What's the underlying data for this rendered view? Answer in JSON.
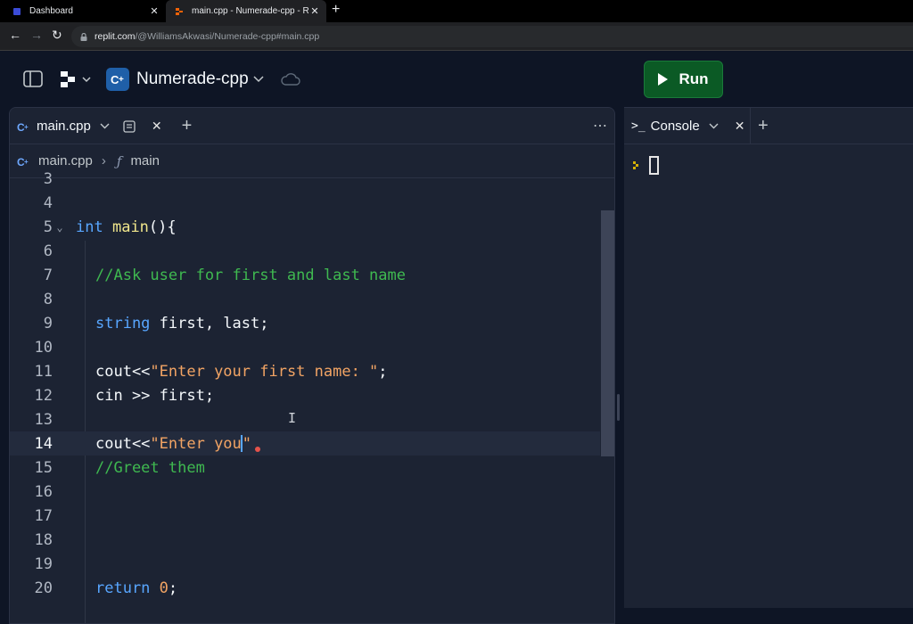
{
  "browser": {
    "tabs": [
      {
        "title": "Dashboard",
        "active": false
      },
      {
        "title": "main.cpp - Numerade-cpp - Replit",
        "active": true
      }
    ],
    "url_host": "replit.com",
    "url_path": "/@WilliamsAkwasi/Numerade-cpp#main.cpp"
  },
  "header": {
    "repl_name": "Numerade-cpp",
    "run_label": "Run"
  },
  "editor": {
    "tab_label": "main.cpp",
    "breadcrumb": {
      "file": "main.cpp",
      "symbol": "main"
    },
    "lines": [
      {
        "n": "3"
      },
      {
        "n": "4"
      },
      {
        "n": "5"
      },
      {
        "n": "6"
      },
      {
        "n": "7"
      },
      {
        "n": "8"
      },
      {
        "n": "9"
      },
      {
        "n": "10"
      },
      {
        "n": "11"
      },
      {
        "n": "12"
      },
      {
        "n": "13"
      },
      {
        "n": "14"
      },
      {
        "n": "15"
      },
      {
        "n": "16"
      },
      {
        "n": "17"
      },
      {
        "n": "18"
      },
      {
        "n": "19"
      },
      {
        "n": "20"
      }
    ],
    "code": {
      "l5_kw": "int",
      "l5_fn": "main",
      "l5_rest": "(){",
      "l7": "//Ask user for first and last name",
      "l9_kw": "string",
      "l9_rest": " first, last;",
      "l11_a": "cout<<",
      "l11_str": "\"Enter your first name: \"",
      "l11_b": ";",
      "l12": "cin >> first;",
      "l14_a": "cout<<",
      "l14_str": "\"Enter you",
      "l14_str2": "\"",
      "l15": "//Greet them",
      "l20_kw": "return",
      "l20_num": "0",
      "l20_b": ";"
    }
  },
  "console": {
    "tab_label": "Console"
  },
  "colors": {
    "run_button": "#0b5a25",
    "keyword": "#58a6ff",
    "comment": "#3fb950",
    "string": "#f2a464",
    "background": "#1c2333"
  }
}
